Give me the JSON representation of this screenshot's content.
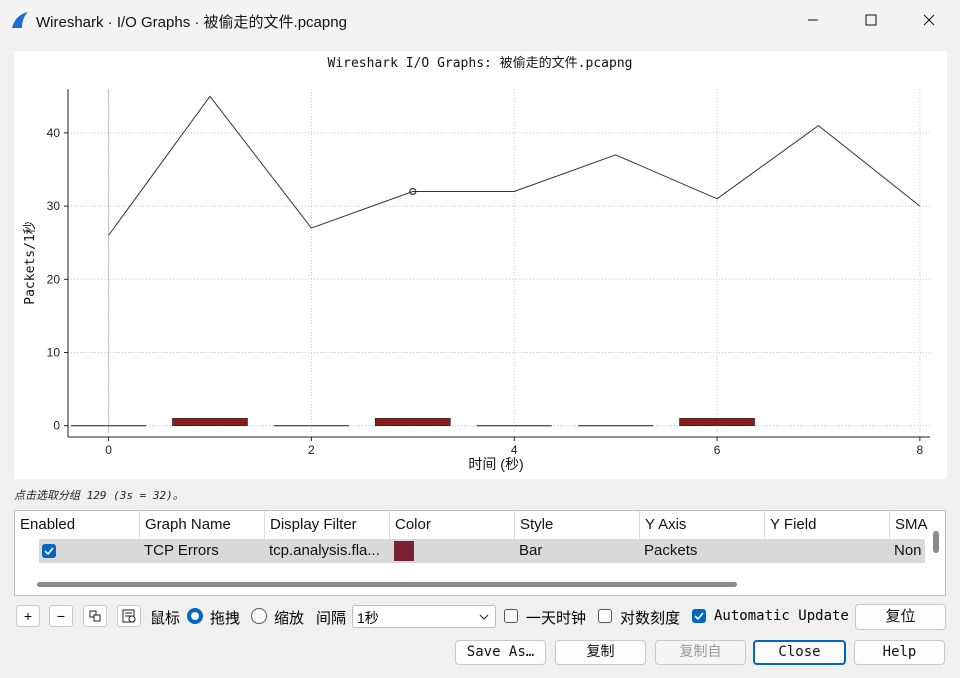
{
  "window": {
    "title": "Wireshark · I/O Graphs · 被偷走的文件.pcapng"
  },
  "plot": {
    "title": "Wireshark I/O Graphs: 被偷走的文件.pcapng",
    "ylabel": "Packets/1秒",
    "xlabel": "时间 (秒)"
  },
  "chart_data": {
    "type": "line",
    "title": "Wireshark I/O Graphs: 被偷走的文件.pcapng",
    "xlabel": "时间 (秒)",
    "ylabel": "Packets/1秒",
    "xlim": [
      -0.4,
      8.1
    ],
    "ylim": [
      -1,
      46
    ],
    "xticks": [
      "0",
      "2",
      "4",
      "6",
      "8"
    ],
    "yticks": [
      "0",
      "10",
      "20",
      "30",
      "40"
    ],
    "grid": true,
    "line_series": {
      "x": [
        0,
        1,
        2,
        3,
        4,
        5,
        6,
        7,
        8
      ],
      "values": [
        26,
        45,
        27,
        32,
        32,
        37,
        31,
        41,
        30
      ],
      "color": "#333333"
    },
    "highlight_point": {
      "x": 3,
      "y": 32
    },
    "bar_series": {
      "name": "TCP Errors",
      "x": [
        0,
        1,
        2,
        3,
        4,
        5,
        6
      ],
      "values": [
        0,
        1,
        0,
        1,
        0,
        0,
        1
      ],
      "color": "#8b1a1a"
    }
  },
  "status": "点击选取分组 129 (3s = 32)。",
  "table": {
    "headers": [
      "Enabled",
      "Graph Name",
      "Display Filter",
      "Color",
      "Style",
      "Y Axis",
      "Y Field",
      "SMA"
    ],
    "row": {
      "enabled": true,
      "graph_name": "TCP Errors",
      "display_filter": "tcp.analysis.fla...",
      "color": "#7b2030",
      "style": "Bar",
      "y_axis": "Packets",
      "y_field": "",
      "sma": "Non"
    }
  },
  "controls": {
    "add": "+",
    "remove": "−",
    "mouse_label": "鼠标",
    "drag_label": "拖拽",
    "zoom_label": "缩放",
    "interval_label": "间隔",
    "interval_value": "1秒",
    "time_of_day_label": "一天时钟",
    "log_scale_label": "对数刻度",
    "auto_update_label": "Automatic Update",
    "reset_label": "复位"
  },
  "buttons": {
    "save_as": "Save As…",
    "copy": "复制",
    "copy_from": "复制自",
    "close": "Close",
    "help": "Help"
  },
  "state": {
    "drag_selected": true,
    "time_of_day": false,
    "log_scale": false,
    "auto_update": true
  }
}
